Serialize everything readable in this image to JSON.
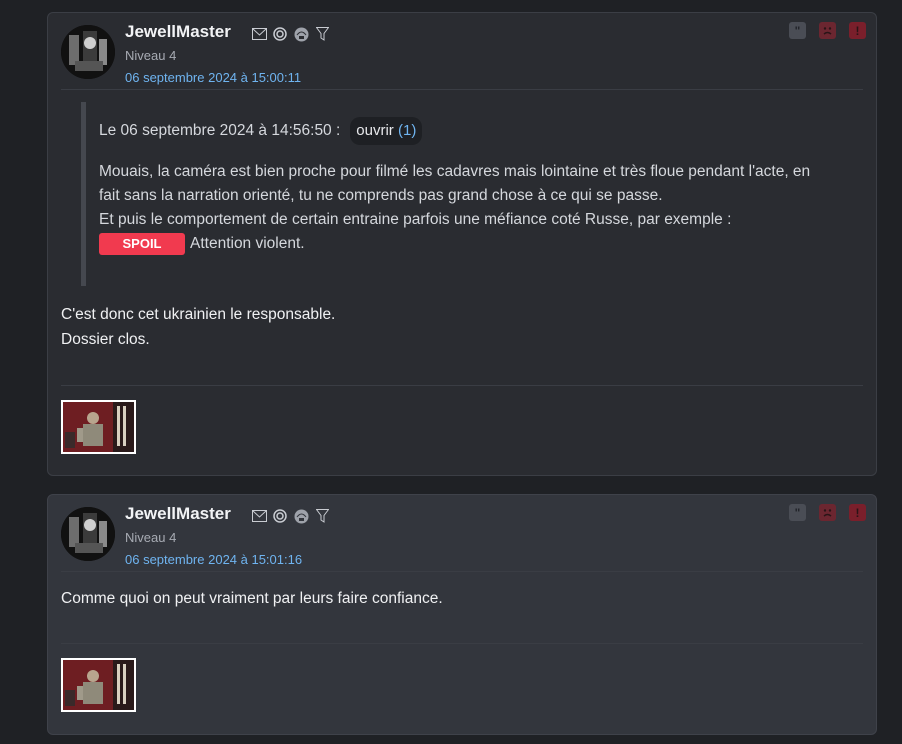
{
  "posts": [
    {
      "author": "JewellMaster",
      "level": "Niveau 4",
      "date": "06 septembre 2024 à 15:00:11",
      "quote": {
        "header": "Le 06 septembre 2024 à 14:56:50 :",
        "open_label": "ouvrir",
        "open_count": "(1)",
        "line1": "Mouais, la caméra est bien proche pour filmé les cadavres mais lointaine et très floue pendant l'acte, en",
        "line2": "fait sans la narration orienté, tu ne comprends pas grand chose à ce qui se passe.",
        "line3": "Et puis le comportement de certain entraine parfois une méfiance coté Russe, par exemple :",
        "spoil_label": "SPOIL",
        "after_spoil": "Attention violent."
      },
      "body_line1": "C'est donc cet ukrainien le responsable.",
      "body_line2": "Dossier clos."
    },
    {
      "author": "JewellMaster",
      "level": "Niveau 4",
      "date": "06 septembre 2024 à 15:01:16",
      "body_line1": "Comme quoi on peut vraiment par leurs faire confiance."
    }
  ],
  "icons": {
    "meta": [
      "mail-icon",
      "spiral-icon",
      "globe-icon",
      "filter-icon"
    ],
    "actions": [
      "quote-icon",
      "sad-face-icon",
      "alert-icon"
    ]
  },
  "colors": {
    "date": "#6fb4f0",
    "spoil": "#f13a4f",
    "action_red": "#7a1f2b"
  }
}
